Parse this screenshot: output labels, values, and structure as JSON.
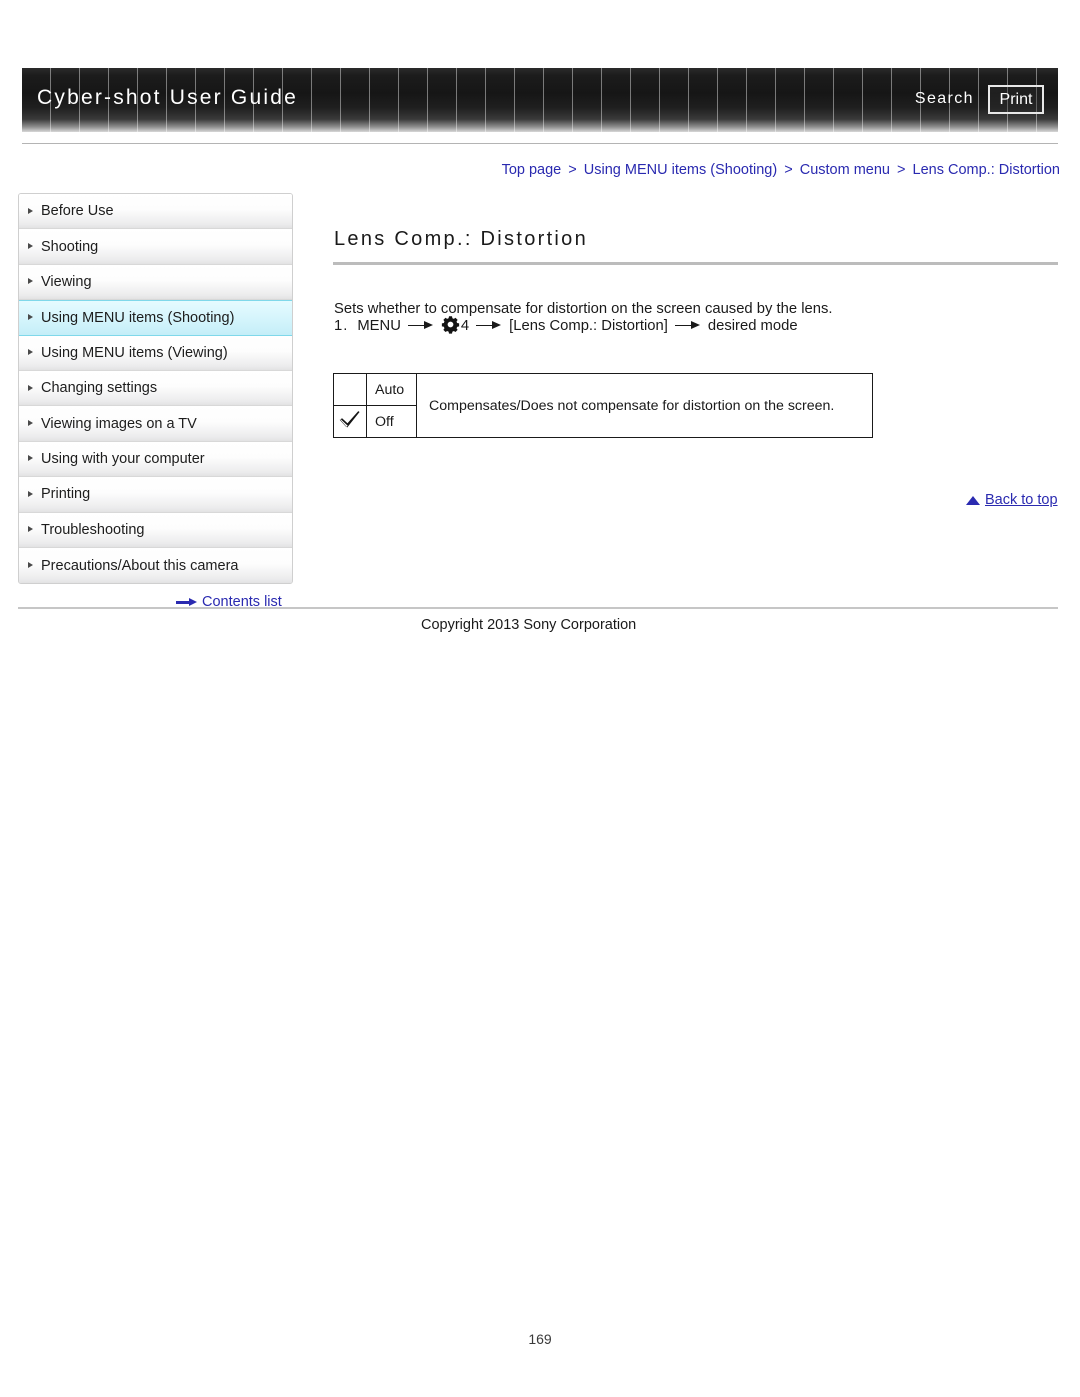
{
  "header": {
    "title": "Cyber-shot User Guide",
    "search_label": "Search",
    "print_label": "Print"
  },
  "breadcrumb": {
    "items": [
      "Top page",
      "Using MENU items (Shooting)",
      "Custom menu",
      "Lens Comp.: Distortion"
    ],
    "separator": ">"
  },
  "sidebar": {
    "items": [
      {
        "label": "Before Use",
        "selected": false
      },
      {
        "label": "Shooting",
        "selected": false
      },
      {
        "label": "Viewing",
        "selected": false
      },
      {
        "label": "Using MENU items (Shooting)",
        "selected": true
      },
      {
        "label": "Using MENU items (Viewing)",
        "selected": false
      },
      {
        "label": "Changing settings",
        "selected": false
      },
      {
        "label": "Viewing images on a TV",
        "selected": false
      },
      {
        "label": "Using with your computer",
        "selected": false
      },
      {
        "label": "Printing",
        "selected": false
      },
      {
        "label": "Troubleshooting",
        "selected": false
      },
      {
        "label": "Precautions/About this camera",
        "selected": false
      }
    ],
    "contents_list_label": "Contents list"
  },
  "main": {
    "title": "Lens Comp.: Distortion",
    "intro": "Sets whether to compensate for distortion on the screen caused by the lens.",
    "step": {
      "number": "1.",
      "menu_label": "MENU",
      "gear_number": "4",
      "bracket_label": "[Lens Comp.: Distortion]",
      "final_label": "desired mode"
    },
    "table": {
      "rows": [
        {
          "checked": false,
          "mode": "Auto"
        },
        {
          "checked": true,
          "mode": "Off"
        }
      ],
      "description": "Compensates/Does not compensate for distortion on the screen."
    },
    "back_to_top_label": "Back to top"
  },
  "footer": {
    "copyright": "Copyright 2013 Sony Corporation",
    "page_number": "169"
  },
  "colors": {
    "link": "#2a2ab0",
    "selected_nav": "#c4eef8",
    "header_dark": "#161616"
  }
}
